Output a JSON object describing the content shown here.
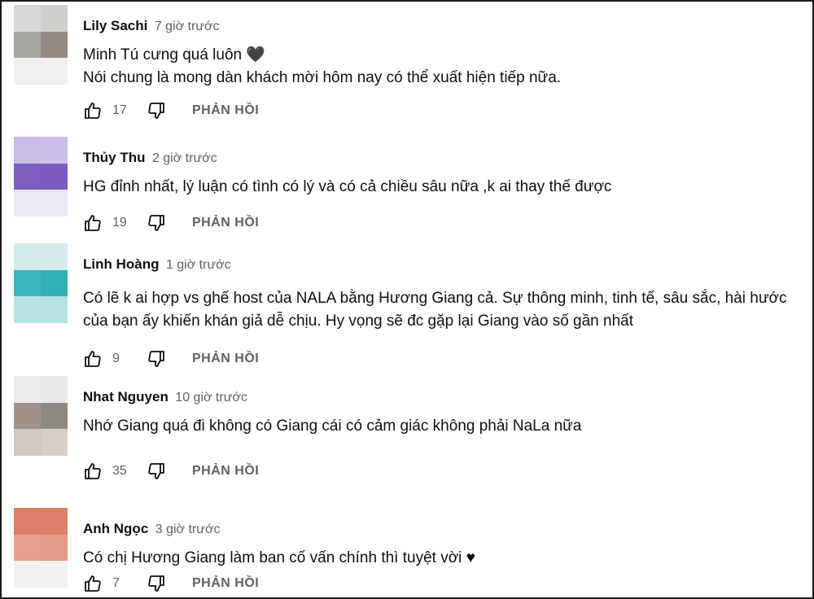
{
  "labels": {
    "reply": "PHẢN HỒI"
  },
  "comments": [
    {
      "author": "Lily Sachi",
      "time": "7 giờ trước",
      "text": "Minh Tú cưng quá luôn 🖤\nNói chung là mong dàn khách mời hôm nay có thể xuất hiện tiếp nữa.",
      "likes": "17",
      "avatar": [
        "#d8d8d8",
        "#d0cfcd",
        "#a8a6a3",
        "#958b83",
        "#efefef",
        "#f0f0f0"
      ]
    },
    {
      "author": "Thủy Thu",
      "time": "2 giờ trước",
      "text": "HG đỉnh nhất, lý luận có tình có lý và có cả chiều sâu nữa ,k ai thay thế được",
      "likes": "19",
      "avatar": [
        "#c9bde6",
        "#cabfe8",
        "#7d5fc0",
        "#7a5cbf",
        "#ebe8f4",
        "#ebe8f3"
      ]
    },
    {
      "author": "Linh Hoàng",
      "time": "1 giờ trước",
      "text": "Có lẽ k ai hợp vs ghế host của NALA bằng Hương Giang cả. Sự thông minh, tinh tế, sâu sắc, hài hước của bạn ấy khiến khán giả dễ chịu. Hy vọng sẽ đc gặp lại Giang vào số gần nhất",
      "likes": "9",
      "avatar": [
        "#d3eaea",
        "#d5ebeb",
        "#3cb7bd",
        "#2fb1b6",
        "#b8e3e4",
        "#b6e2e3"
      ]
    },
    {
      "author": "Nhat Nguyen",
      "time": "10 giờ trước",
      "text": "Nhớ Giang quá đi không có Giang cái có cảm giác không phải NaLa nữa",
      "likes": "35",
      "avatar": [
        "#ececec",
        "#e8e8e8",
        "#a0948a",
        "#8e8a81",
        "#cfc7c1",
        "#d6cfc9"
      ]
    },
    {
      "author": "Anh Ngọc",
      "time": "3 giờ trước",
      "text": "Có chị Hương Giang làm ban cố vấn chính thì tuyệt vời ♥",
      "likes": "7",
      "avatar": [
        "#df7e68",
        "#df806a",
        "#e7a08e",
        "#e49c8a",
        "#f0f0f0",
        "#f0f0f0"
      ]
    }
  ]
}
